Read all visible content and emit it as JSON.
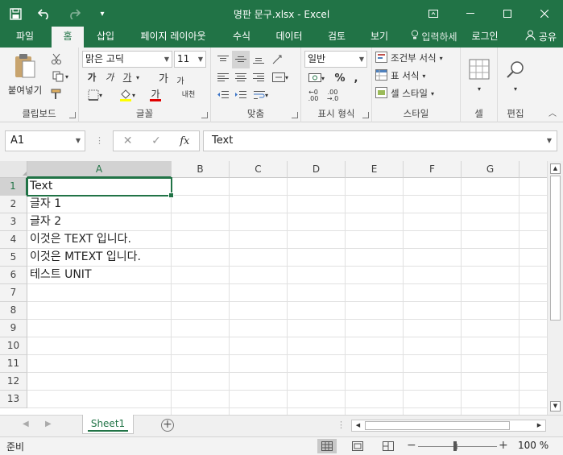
{
  "window": {
    "title": "명판 문구.xlsx - Excel"
  },
  "ribbon_tabs": [
    {
      "label": "파일"
    },
    {
      "label": "홈"
    },
    {
      "label": "삽입"
    },
    {
      "label": "페이지 레이아웃"
    },
    {
      "label": "수식"
    },
    {
      "label": "데이터"
    },
    {
      "label": "검토"
    },
    {
      "label": "보기"
    }
  ],
  "tell_me": "입력하세",
  "login": "로그인",
  "share": "공유",
  "ribbon": {
    "clipboard": {
      "paste": "붙여넣기",
      "label": "클립보드"
    },
    "font": {
      "name": "맑은 고딕",
      "size": "11",
      "label": "글꼴",
      "bold": "가",
      "italic": "가",
      "underline": "가",
      "grow": "가",
      "shrink": "가",
      "color": "가",
      "phonetic": "내천"
    },
    "alignment": {
      "label": "맞춤"
    },
    "number": {
      "format": "일반",
      "label": "표시 형식"
    },
    "styles": {
      "conditional": "조건부 서식",
      "table": "표 서식",
      "cell": "셀 스타일",
      "label": "스타일"
    },
    "cells": {
      "label": "셀"
    },
    "editing": {
      "label": "편집"
    }
  },
  "formula_bar": {
    "name_box": "A1",
    "formula": "Text",
    "fx": "fx"
  },
  "columns": [
    "A",
    "B",
    "C",
    "D",
    "E",
    "F",
    "G"
  ],
  "rows": [
    "1",
    "2",
    "3",
    "4",
    "5",
    "6",
    "7",
    "8",
    "9",
    "10",
    "11",
    "12",
    "13"
  ],
  "cells_a": [
    "Text",
    "글자 1",
    "글자 2",
    "이것은 TEXT 입니다.",
    "이것은 MTEXT 입니다.",
    "테스트 UNIT"
  ],
  "sheets": [
    {
      "label": "Sheet1"
    }
  ],
  "status": {
    "ready": "준비",
    "zoom": "100 %"
  },
  "accent_color": "#217346"
}
